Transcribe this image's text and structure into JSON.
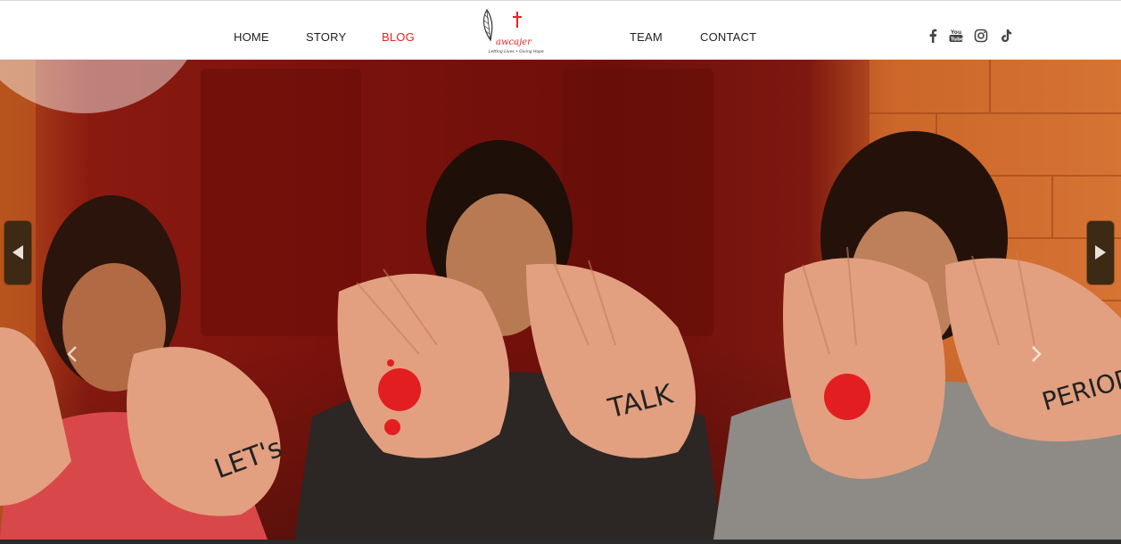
{
  "nav": {
    "left": [
      "HOME",
      "STORY",
      "BLOG"
    ],
    "right": [
      "TEAM",
      "CONTACT"
    ],
    "active": "BLOG"
  },
  "logo": {
    "name": "awcajer",
    "tagline": "Letting ... Lives ..."
  },
  "social": [
    "facebook-icon",
    "youtube-icon",
    "instagram-icon",
    "tiktok-icon"
  ],
  "hero": {
    "hand_texts": [
      "LET's",
      "TALK",
      "PERIOD"
    ],
    "prev_label": "previous",
    "next_label": "next"
  },
  "colors": {
    "accent": "#e5241f",
    "nav_text": "#222222",
    "arrow_bg": "#3d2a14"
  }
}
